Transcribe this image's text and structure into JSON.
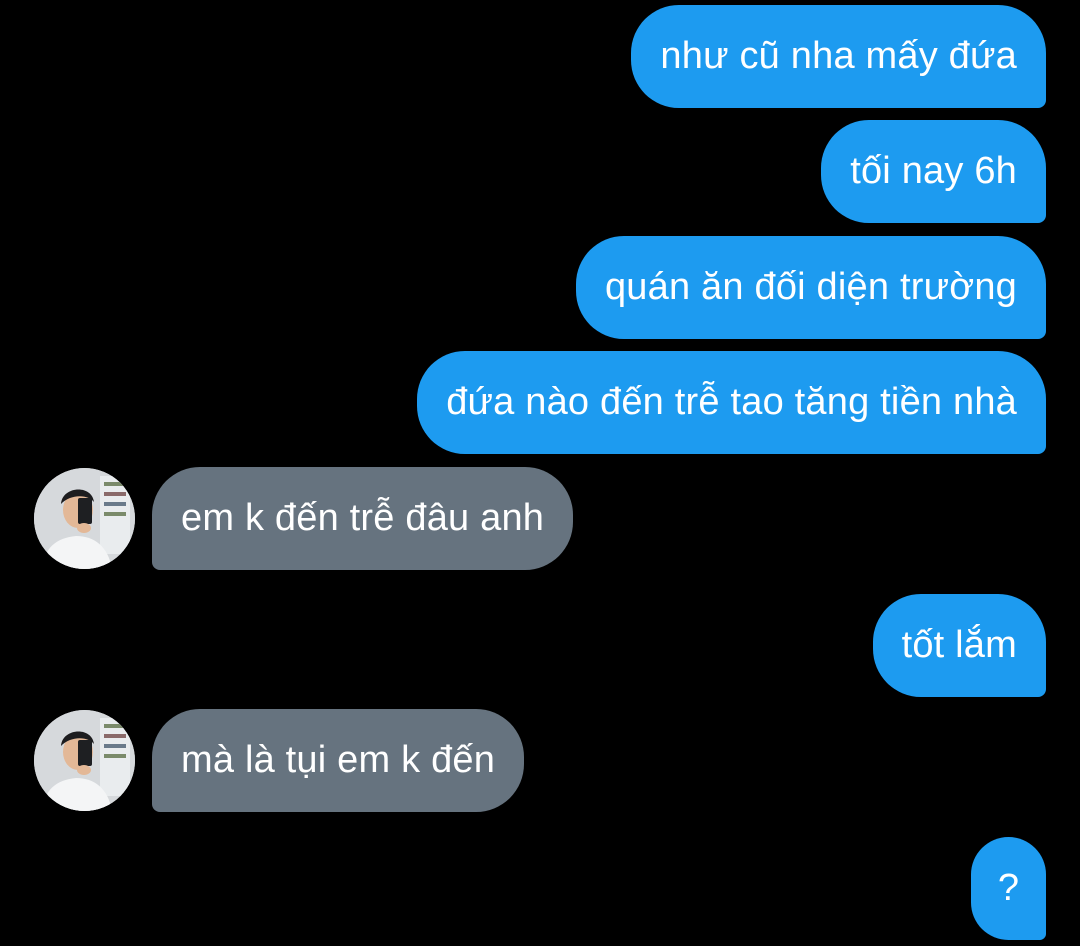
{
  "conversation": {
    "messages": [
      {
        "direction": "outgoing",
        "text": "như cũ nha mấy đứa"
      },
      {
        "direction": "outgoing",
        "text": "tối nay 6h"
      },
      {
        "direction": "outgoing",
        "text": "quán ăn đối diện trường"
      },
      {
        "direction": "outgoing",
        "text": "đứa nào đến trễ tao tăng tiền nhà"
      },
      {
        "direction": "incoming",
        "text": "em k đến trễ đâu anh",
        "avatar": "user-avatar"
      },
      {
        "direction": "outgoing",
        "text": "tốt lắm"
      },
      {
        "direction": "incoming",
        "text": "mà là tụi em k đến",
        "avatar": "user-avatar"
      },
      {
        "direction": "outgoing",
        "text": "?"
      }
    ]
  },
  "colors": {
    "background": "#000000",
    "outgoing_bubble": "#1d9bf0",
    "incoming_bubble": "#66737f",
    "text": "#ffffff"
  }
}
